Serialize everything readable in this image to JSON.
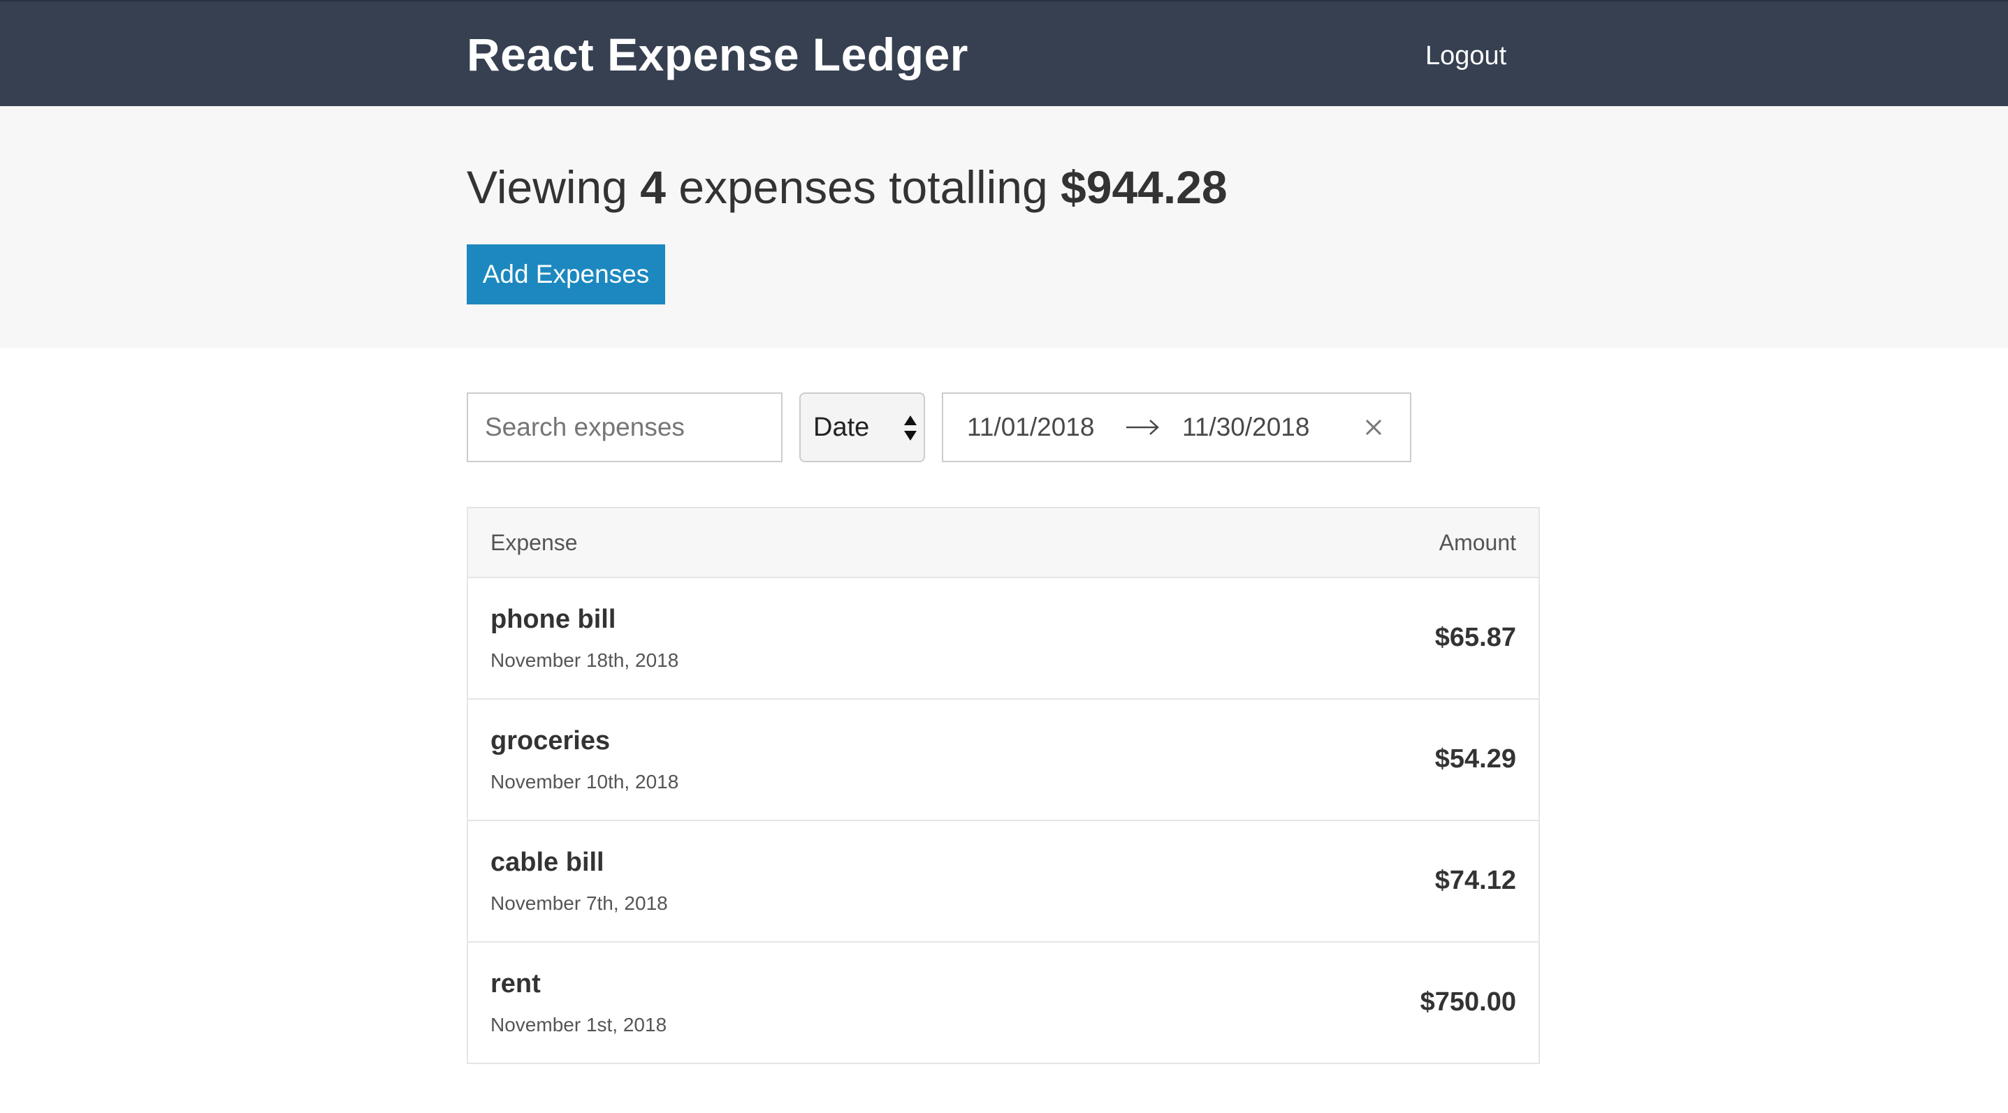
{
  "header": {
    "title": "React Expense Ledger",
    "logout_label": "Logout"
  },
  "summary": {
    "prefix": "Viewing",
    "count": "4",
    "middle": "expenses totalling",
    "total": "$944.28",
    "add_button_label": "Add Expenses"
  },
  "filters": {
    "search_placeholder": "Search expenses",
    "search_value": "",
    "sort_selected": "Date",
    "start_date": "11/01/2018",
    "end_date": "11/30/2018"
  },
  "table": {
    "headers": {
      "expense": "Expense",
      "amount": "Amount"
    },
    "rows": [
      {
        "description": "phone bill",
        "date": "November 18th, 2018",
        "amount": "$65.87"
      },
      {
        "description": "groceries",
        "date": "November 10th, 2018",
        "amount": "$54.29"
      },
      {
        "description": "cable bill",
        "date": "November 7th, 2018",
        "amount": "$74.12"
      },
      {
        "description": "rent",
        "date": "November 1st, 2018",
        "amount": "$750.00"
      }
    ]
  },
  "icons": {
    "sort": "sort-arrows-icon",
    "range_arrow": "arrow-right-icon",
    "clear": "close-icon"
  },
  "colors": {
    "header_bg": "#364051",
    "summary_bg": "#f7f7f7",
    "primary_button": "#1c88bf"
  }
}
